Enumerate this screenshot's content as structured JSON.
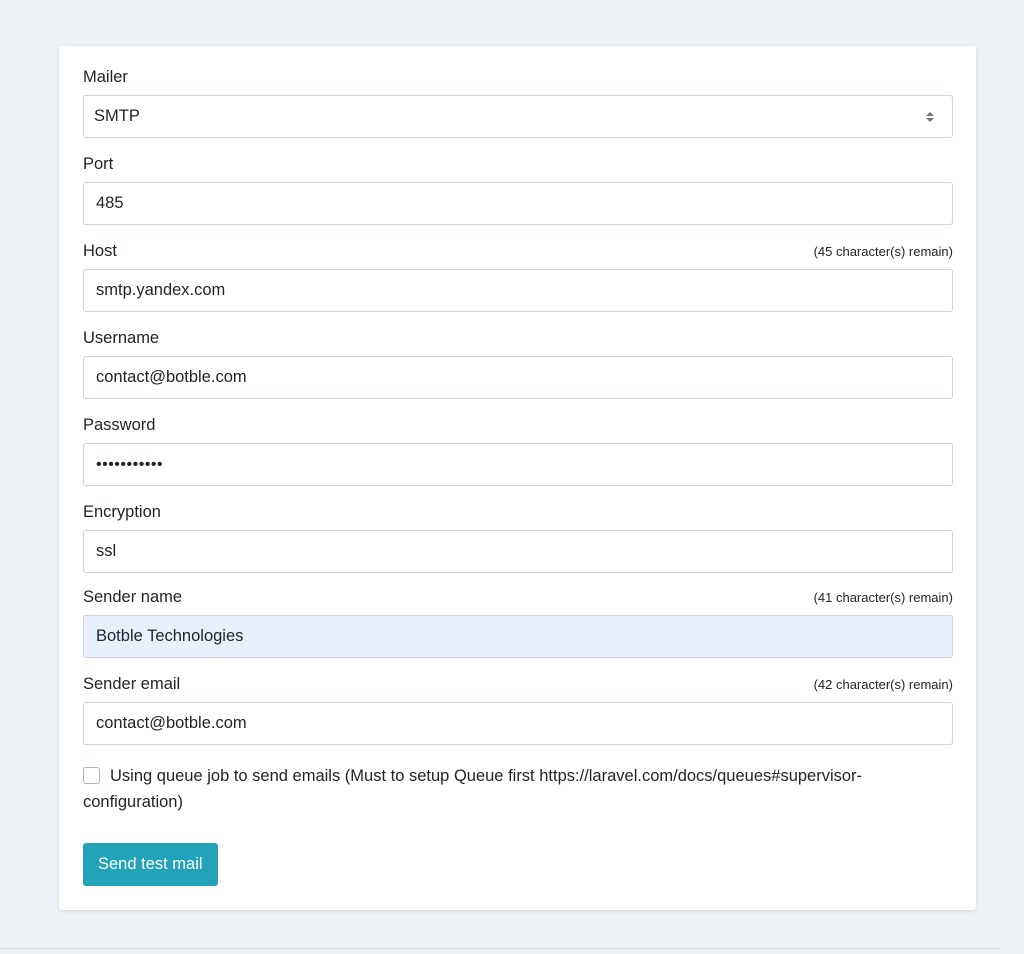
{
  "form": {
    "mailer": {
      "label": "Mailer",
      "value": "SMTP"
    },
    "port": {
      "label": "Port",
      "value": "485"
    },
    "host": {
      "label": "Host",
      "remain": "(45 character(s) remain)",
      "value": "smtp.yandex.com"
    },
    "username": {
      "label": "Username",
      "value": "contact@botble.com"
    },
    "password": {
      "label": "Password",
      "value": "•••••••••••"
    },
    "encryption": {
      "label": "Encryption",
      "value": "ssl"
    },
    "sender_name": {
      "label": "Sender name",
      "remain": "(41 character(s) remain)",
      "value": "Botble Technologies"
    },
    "sender_email": {
      "label": "Sender email",
      "remain": "(42 character(s) remain)",
      "value": "contact@botble.com"
    },
    "queue_checkbox": {
      "label": "Using queue job to send emails (Must to setup Queue first https://laravel.com/docs/queues#supervisor-configuration)",
      "checked": false
    },
    "send_test_button": "Send test mail"
  },
  "colors": {
    "page_bg": "#eef1f6",
    "card_bg": "#ffffff",
    "button_bg": "#23a3b8",
    "autofill_bg": "#e8f0fe"
  }
}
